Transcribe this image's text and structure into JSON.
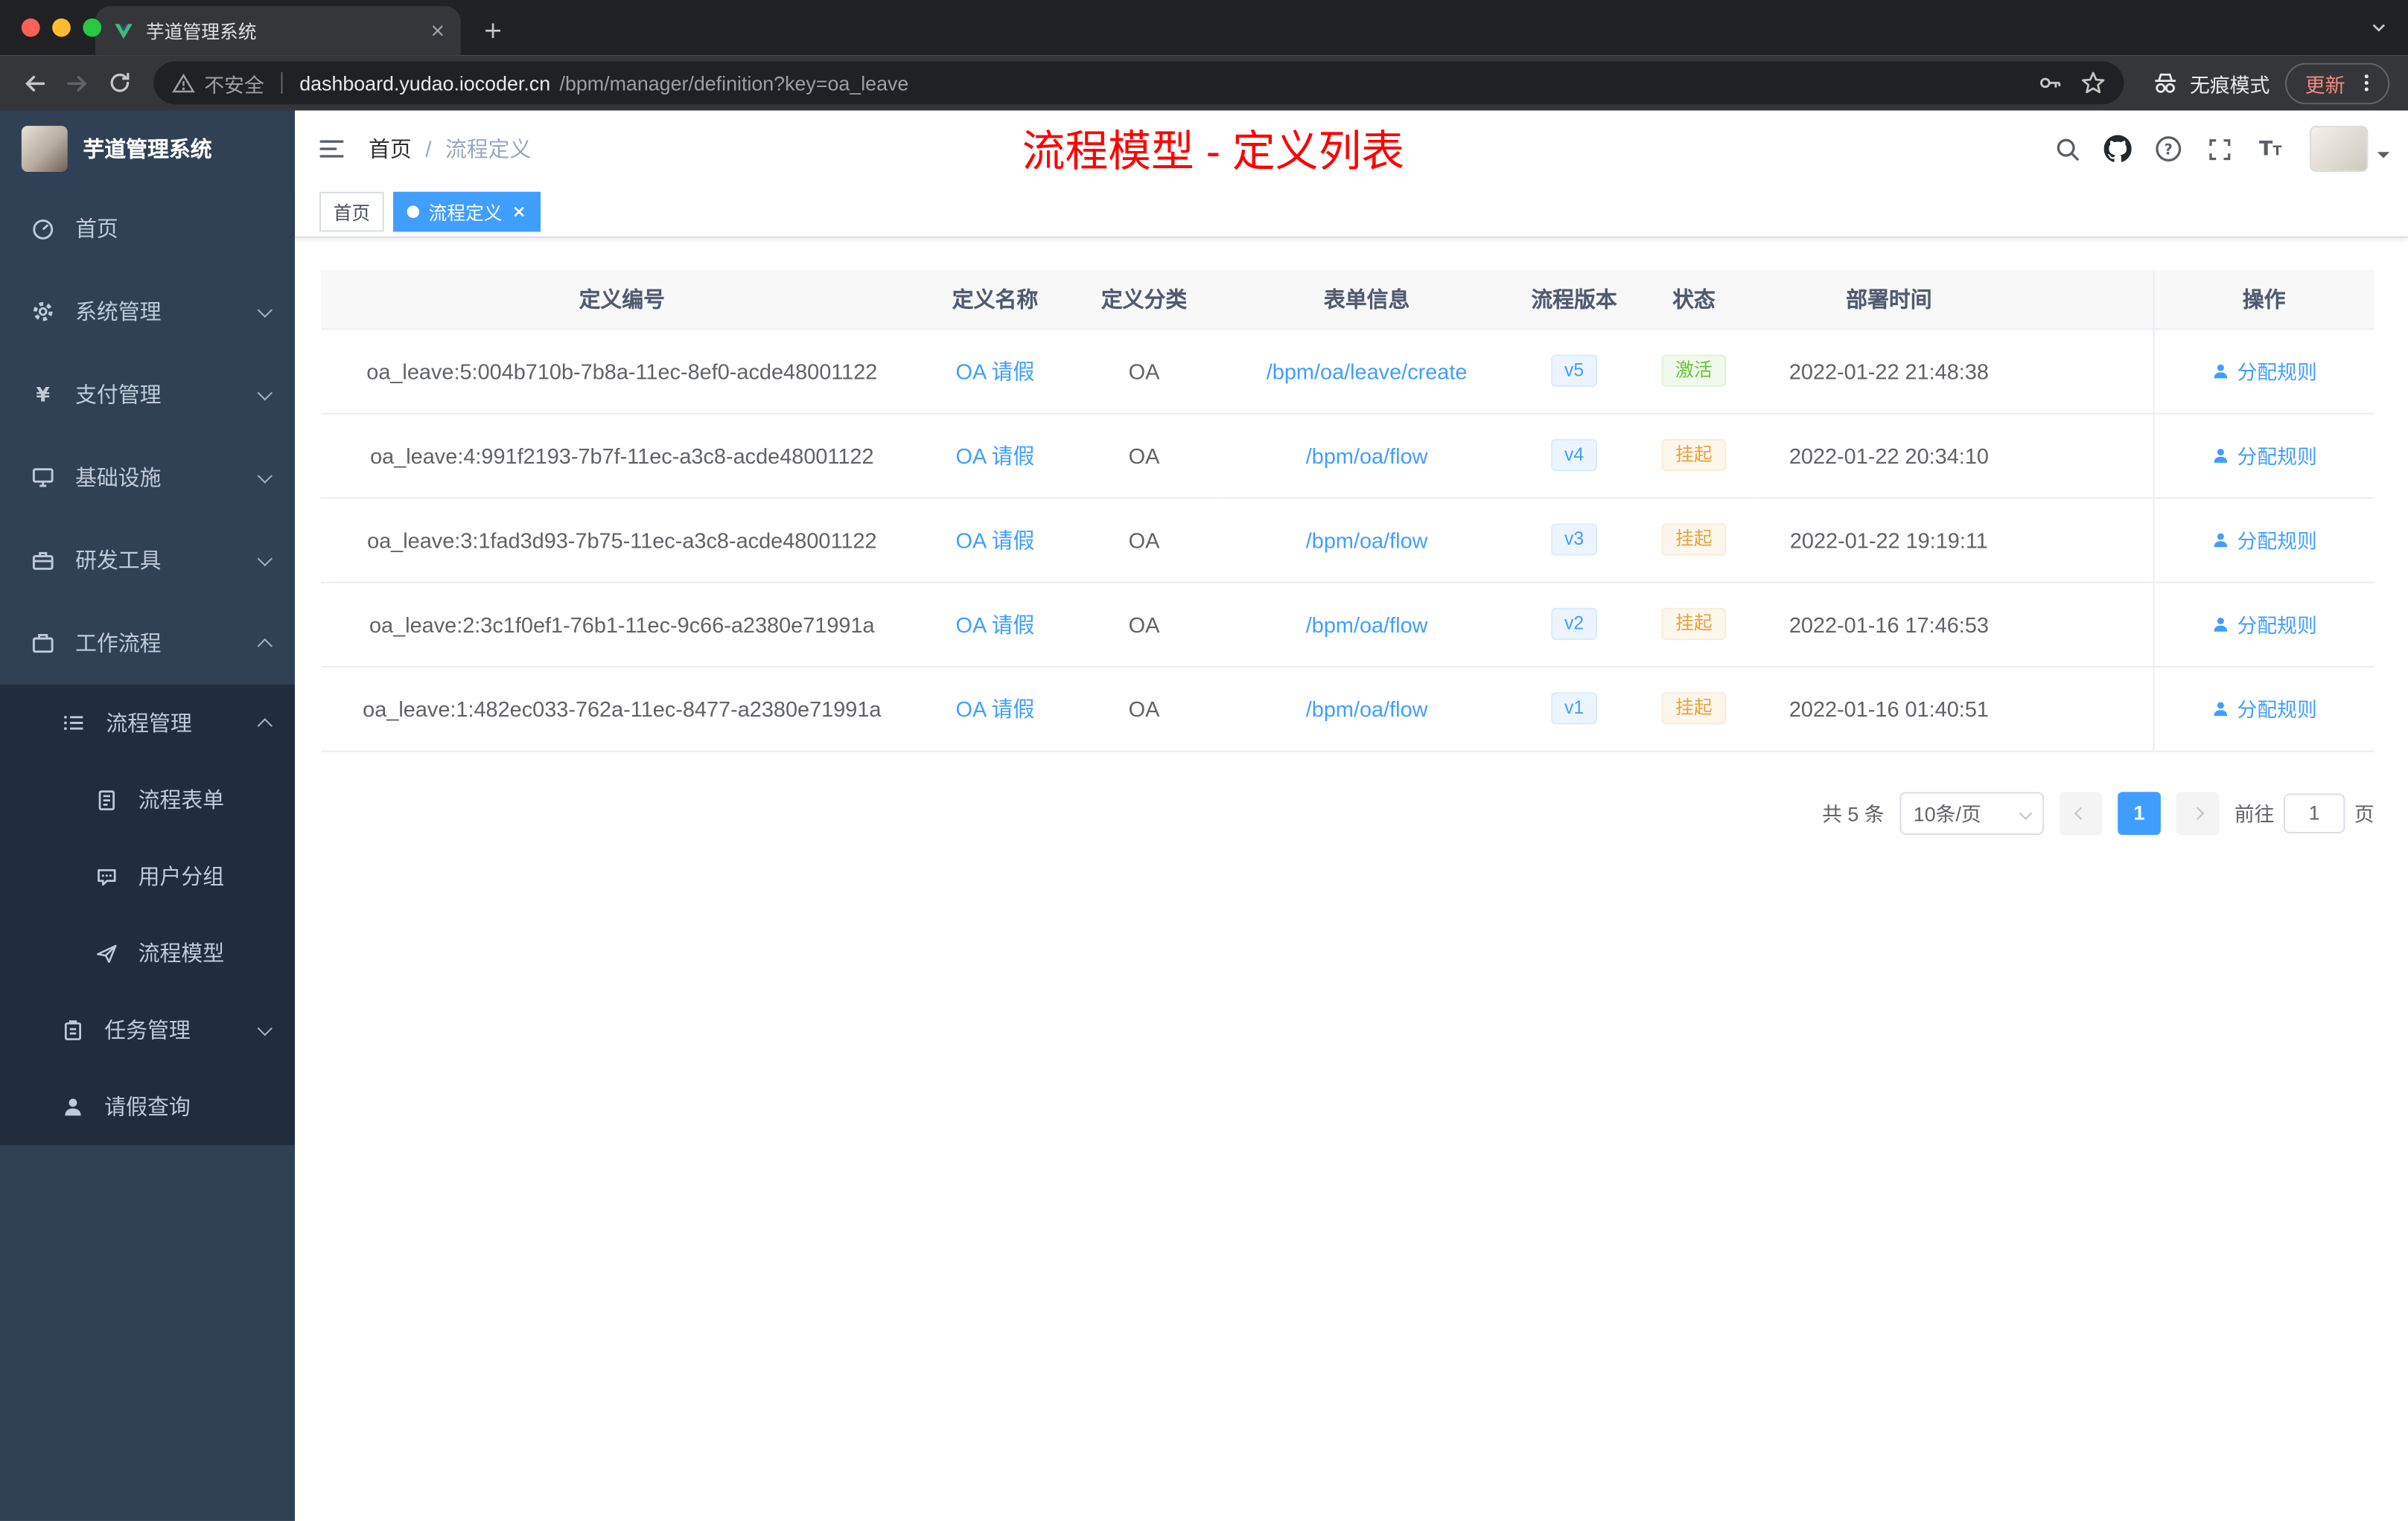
{
  "browser": {
    "tab_title": "芋道管理系统",
    "security_label": "不安全",
    "url_host": "dashboard.yudao.iocoder.cn",
    "url_path": "/bpm/manager/definition?key=oa_leave",
    "incognito_label": "无痕模式",
    "update_label": "更新"
  },
  "sidebar": {
    "app_title": "芋道管理系统",
    "items": [
      {
        "label": "首页",
        "icon": "dashboard-icon"
      },
      {
        "label": "系统管理",
        "icon": "gear-icon"
      },
      {
        "label": "支付管理",
        "icon": "yen-icon"
      },
      {
        "label": "基础设施",
        "icon": "infrastructure-icon"
      },
      {
        "label": "研发工具",
        "icon": "devtools-icon"
      },
      {
        "label": "工作流程",
        "icon": "workflow-icon"
      }
    ],
    "submenu": [
      {
        "label": "流程管理",
        "icon": "process-list-icon"
      },
      {
        "label": "流程表单",
        "icon": "form-icon"
      },
      {
        "label": "用户分组",
        "icon": "user-group-icon"
      },
      {
        "label": "流程模型",
        "icon": "paper-plane-icon"
      },
      {
        "label": "任务管理",
        "icon": "task-icon"
      },
      {
        "label": "请假查询",
        "icon": "person-icon"
      }
    ]
  },
  "header": {
    "breadcrumb_home": "首页",
    "breadcrumb_sep": "/",
    "breadcrumb_current": "流程定义",
    "overlay_title": "流程模型 - 定义列表"
  },
  "tags": {
    "home": "首页",
    "active": "流程定义"
  },
  "table": {
    "columns": [
      "定义编号",
      "定义名称",
      "定义分类",
      "表单信息",
      "流程版本",
      "状态",
      "部署时间",
      "操作"
    ],
    "rows": [
      {
        "id": "oa_leave:5:004b710b-7b8a-11ec-8ef0-acde48001122",
        "name": "OA 请假",
        "category": "OA",
        "form": "/bpm/oa/leave/create",
        "version": "v5",
        "status": "激活",
        "status_type": "success",
        "time": "2022-01-22 21:48:38",
        "action": "分配规则"
      },
      {
        "id": "oa_leave:4:991f2193-7b7f-11ec-a3c8-acde48001122",
        "name": "OA 请假",
        "category": "OA",
        "form": "/bpm/oa/flow",
        "version": "v4",
        "status": "挂起",
        "status_type": "warning",
        "time": "2022-01-22 20:34:10",
        "action": "分配规则"
      },
      {
        "id": "oa_leave:3:1fad3d93-7b75-11ec-a3c8-acde48001122",
        "name": "OA 请假",
        "category": "OA",
        "form": "/bpm/oa/flow",
        "version": "v3",
        "status": "挂起",
        "status_type": "warning",
        "time": "2022-01-22 19:19:11",
        "action": "分配规则"
      },
      {
        "id": "oa_leave:2:3c1f0ef1-76b1-11ec-9c66-a2380e71991a",
        "name": "OA 请假",
        "category": "OA",
        "form": "/bpm/oa/flow",
        "version": "v2",
        "status": "挂起",
        "status_type": "warning",
        "time": "2022-01-16 17:46:53",
        "action": "分配规则"
      },
      {
        "id": "oa_leave:1:482ec033-762a-11ec-8477-a2380e71991a",
        "name": "OA 请假",
        "category": "OA",
        "form": "/bpm/oa/flow",
        "version": "v1",
        "status": "挂起",
        "status_type": "warning",
        "time": "2022-01-16 01:40:51",
        "action": "分配规则"
      }
    ]
  },
  "pagination": {
    "total": "共 5 条",
    "page_size": "10条/页",
    "current_page": "1",
    "goto_label": "前往",
    "goto_value": "1",
    "page_unit": "页"
  },
  "colors": {
    "accent": "#409EFF",
    "success": "#67C23A",
    "warning": "#E6A23C",
    "overlay_title_red": "#FF0000",
    "sidebar_bg": "#304156",
    "submenu_bg": "#1F2D3D",
    "table_header_bg": "#F8F8F9"
  }
}
